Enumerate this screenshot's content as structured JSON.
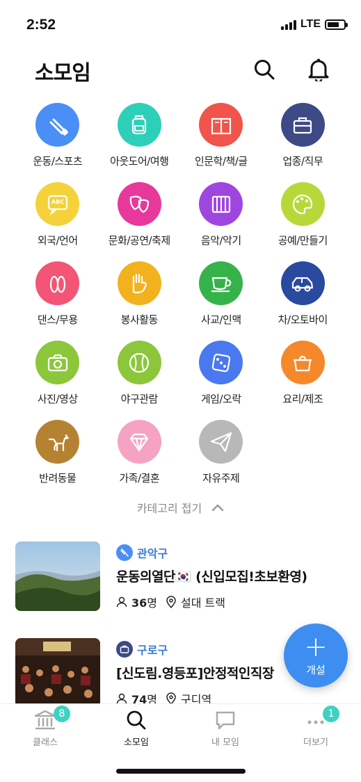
{
  "status_bar": {
    "time": "2:52",
    "network": "LTE",
    "battery_level": 0.72
  },
  "header": {
    "title": "소모임",
    "search_icon": "search-icon",
    "bell_icon": "bell-icon"
  },
  "categories": [
    {
      "label": "운동/스포츠",
      "color": "#4a8ff5",
      "icon": "badminton-icon"
    },
    {
      "label": "아웃도어/여행",
      "color": "#2ecfb8",
      "icon": "backpack-icon"
    },
    {
      "label": "인문학/책/글",
      "color": "#f0544a",
      "icon": "book-icon"
    },
    {
      "label": "업종/직무",
      "color": "#3d4a86",
      "icon": "briefcase-icon"
    },
    {
      "label": "외국/언어",
      "color": "#f5d23a",
      "icon": "speech-bubble-icon"
    },
    {
      "label": "문화/공연/축제",
      "color": "#e8389c",
      "icon": "theater-masks-icon"
    },
    {
      "label": "음악/악기",
      "color": "#a046e0",
      "icon": "piano-icon"
    },
    {
      "label": "공예/만들기",
      "color": "#b8d83a",
      "icon": "palette-icon"
    },
    {
      "label": "댄스/무용",
      "color": "#f25576",
      "icon": "ballet-shoes-icon"
    },
    {
      "label": "봉사활동",
      "color": "#f2b21e",
      "icon": "hand-icon"
    },
    {
      "label": "사교/인맥",
      "color": "#36b24a",
      "icon": "cup-icon"
    },
    {
      "label": "차/오토바이",
      "color": "#2a4aa0",
      "icon": "car-icon"
    },
    {
      "label": "사진/영상",
      "color": "#8cc63a",
      "icon": "camera-icon"
    },
    {
      "label": "야구관람",
      "color": "#8cc63a",
      "icon": "baseball-icon"
    },
    {
      "label": "게임/오락",
      "color": "#4a78f0",
      "icon": "dice-icon"
    },
    {
      "label": "요리/제조",
      "color": "#f5882a",
      "icon": "pot-icon"
    },
    {
      "label": "반려동물",
      "color": "#b58232",
      "icon": "dog-icon"
    },
    {
      "label": "가족/결혼",
      "color": "#f6a2c3",
      "icon": "diamond-icon"
    },
    {
      "label": "자유주제",
      "color": "#b8b8b8",
      "icon": "paper-plane-icon"
    }
  ],
  "collapse_label": "카테고리 접기",
  "groups": [
    {
      "region": "관악구",
      "title": "운동의열단🇰🇷 (신입모집!초보환영)",
      "members": "36",
      "members_unit": "명",
      "location": "설대 트랙",
      "tag_color": "#4a8ff5"
    },
    {
      "region": "구로구",
      "title": "[신도림.영등포]안정적인직장",
      "members": "74",
      "members_unit": "명",
      "location": "구디역",
      "tag_color": "#3d4a86"
    }
  ],
  "fab": {
    "label": "개설",
    "icon": "plus-icon"
  },
  "tabs": [
    {
      "label": "클래스",
      "icon": "bank-icon",
      "badge": "8",
      "active": false
    },
    {
      "label": "소모임",
      "icon": "search-icon",
      "badge": "",
      "active": true
    },
    {
      "label": "내 모임",
      "icon": "chat-icon",
      "badge": "",
      "active": false
    },
    {
      "label": "더보기",
      "icon": "more-icon",
      "badge": "1",
      "active": false
    }
  ]
}
